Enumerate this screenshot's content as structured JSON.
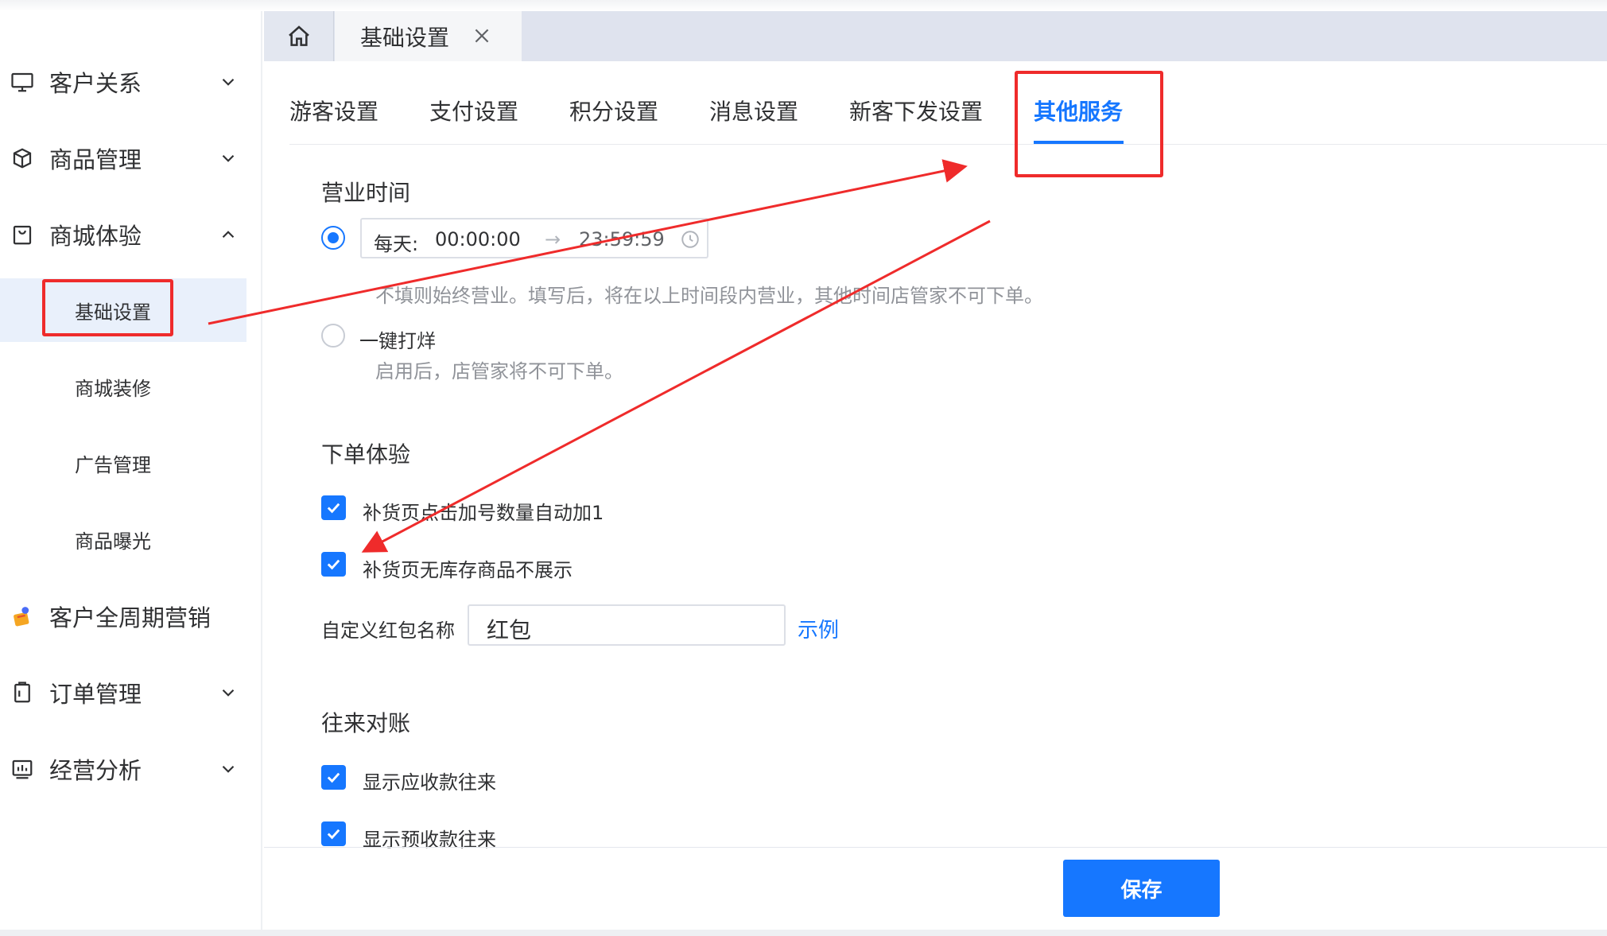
{
  "sidebar": {
    "items": [
      {
        "label": "客户关系",
        "icon": "monitor-icon"
      },
      {
        "label": "商品管理",
        "icon": "box-icon"
      },
      {
        "label": "商城体验",
        "icon": "shopping-bag-icon"
      },
      {
        "label": "客户全周期营销",
        "icon": "marketing-icon"
      },
      {
        "label": "订单管理",
        "icon": "clipboard-icon"
      },
      {
        "label": "经营分析",
        "icon": "chart-icon"
      }
    ],
    "subitems": [
      "基础设置",
      "商城装修",
      "广告管理",
      "商品曝光"
    ]
  },
  "header": {
    "home_icon": "home-icon",
    "tab_label": "基础设置",
    "close_icon": "close-icon"
  },
  "tabs": [
    "游客设置",
    "支付设置",
    "积分设置",
    "消息设置",
    "新客下发设置",
    "其他服务"
  ],
  "active_tab": "其他服务",
  "business_hours": {
    "title": "营业时间",
    "time_prefix": "每天:",
    "start": "00:00:00",
    "arrow": "→",
    "end": "23:59:59",
    "hint": "不填则始终营业。填写后，将在以上时间段内营业，其他时间店管家不可下单。",
    "close_label": "一键打烊",
    "close_hint": "启用后，店管家将不可下单。"
  },
  "order_experience": {
    "title": "下单体验",
    "options": [
      "补货页点击加号数量自动加1",
      "补货页无库存商品不展示"
    ],
    "redpacket_label": "自定义红包名称",
    "redpacket_value": "红包",
    "example_link": "示例"
  },
  "reconciliation": {
    "title": "往来对账",
    "options": [
      "显示应收款往来",
      "显示预收款往来"
    ]
  },
  "footer": {
    "save_label": "保存"
  },
  "colors": {
    "accent": "#1677ff",
    "annotation": "#ef2b2b"
  }
}
